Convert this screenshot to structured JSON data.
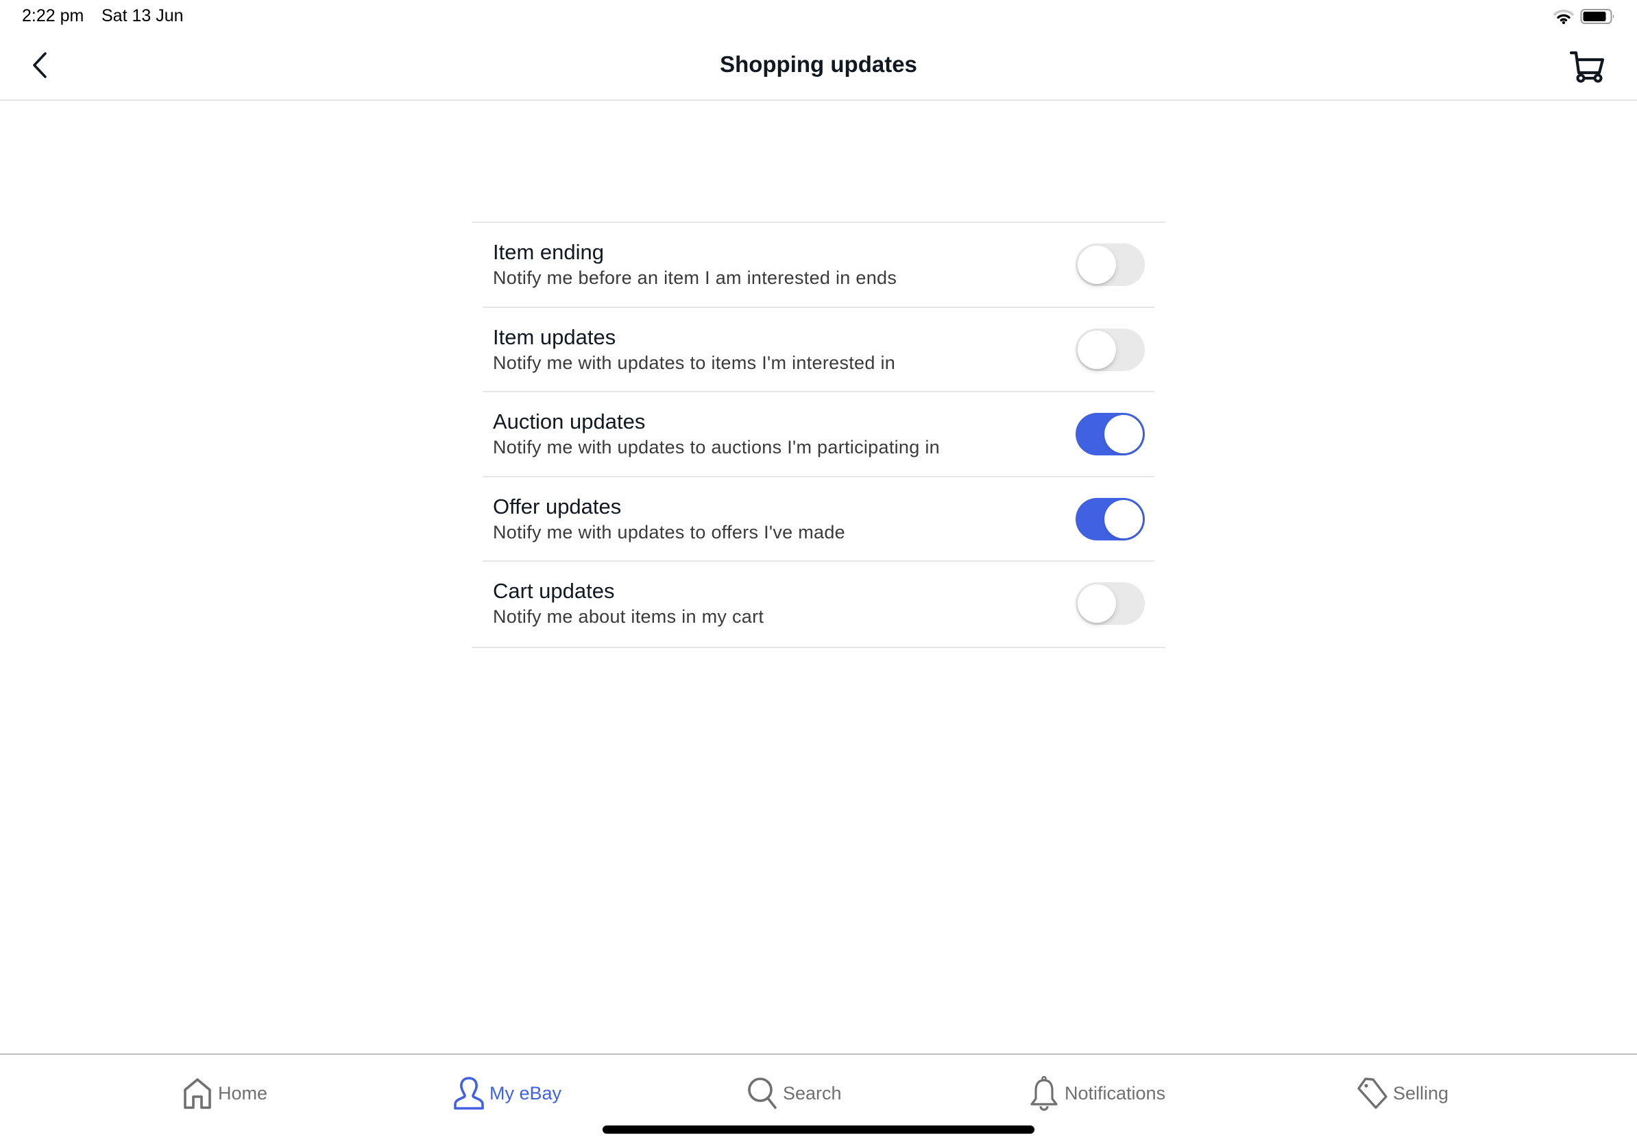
{
  "status_bar": {
    "time": "2:22 pm",
    "date": "Sat 13 Jun",
    "icons": [
      "wifi-icon",
      "battery-icon"
    ]
  },
  "header": {
    "title": "Shopping updates",
    "back_icon": "chevron-left-icon",
    "cart_icon": "cart-icon"
  },
  "settings": [
    {
      "title": "Item ending",
      "description": "Notify me before an item I am interested in ends",
      "enabled": false
    },
    {
      "title": "Item updates",
      "description": "Notify me with updates to items I'm interested in",
      "enabled": false
    },
    {
      "title": "Auction updates",
      "description": "Notify me with updates to auctions I'm participating in",
      "enabled": true
    },
    {
      "title": "Offer updates",
      "description": "Notify me with updates to offers I've made",
      "enabled": true
    },
    {
      "title": "Cart updates",
      "description": "Notify me about items in my cart",
      "enabled": false
    }
  ],
  "tab_bar": {
    "tabs": [
      {
        "label": "Home",
        "icon": "home-icon",
        "active": false
      },
      {
        "label": "My eBay",
        "icon": "user-icon",
        "active": true
      },
      {
        "label": "Search",
        "icon": "search-icon",
        "active": false
      },
      {
        "label": "Notifications",
        "icon": "bell-icon",
        "active": false
      },
      {
        "label": "Selling",
        "icon": "tag-icon",
        "active": false
      }
    ]
  },
  "colors": {
    "accent": "#4062e2",
    "toggle_off": "#e9e9ea",
    "text_primary": "#111820",
    "text_secondary": "#3a3a3a",
    "tab_inactive": "#707070"
  }
}
